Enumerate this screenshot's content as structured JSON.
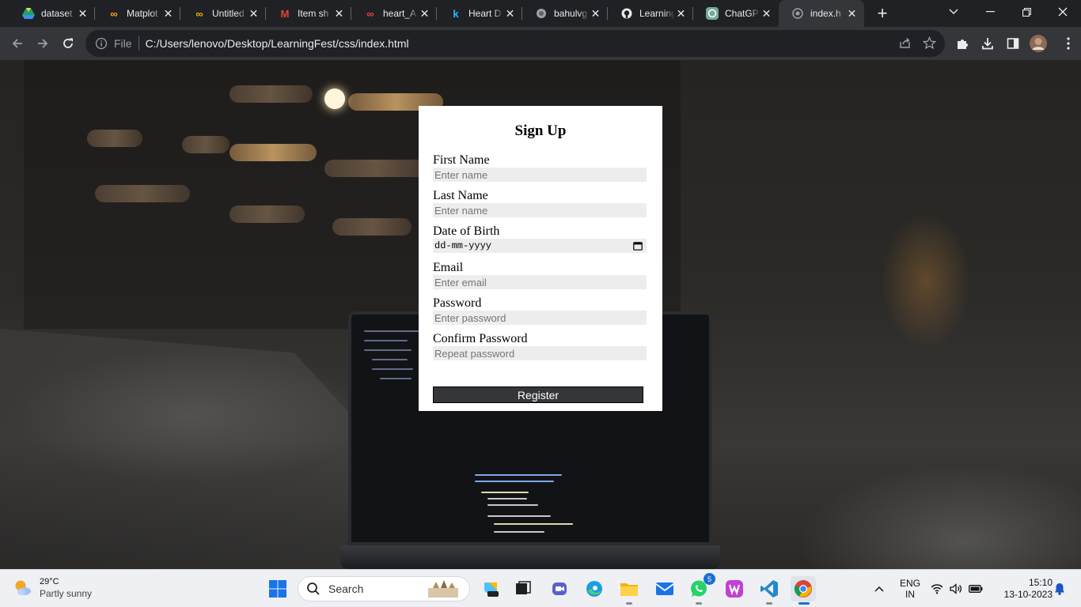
{
  "browser": {
    "tabs": [
      {
        "title": "dataset",
        "icon": "google-drive-icon"
      },
      {
        "title": "Matplot",
        "icon": "colab-icon"
      },
      {
        "title": "Untitled",
        "icon": "colab-icon"
      },
      {
        "title": "Item sh",
        "icon": "gmail-icon"
      },
      {
        "title": "heart_A",
        "icon": "colab-red-icon"
      },
      {
        "title": "Heart D",
        "icon": "kaggle-icon"
      },
      {
        "title": "bahulvg",
        "icon": "globe-icon"
      },
      {
        "title": "Learning",
        "icon": "github-icon"
      },
      {
        "title": "ChatGP",
        "icon": "chatgpt-icon"
      },
      {
        "title": "index.h",
        "icon": "globe-icon",
        "active": true
      }
    ],
    "address": {
      "scheme_label": "File",
      "url": "C:/Users/lenovo/Desktop/LearningFest/css/index.html"
    }
  },
  "signup": {
    "title": "Sign Up",
    "fields": [
      {
        "label": "First Name",
        "placeholder": "Enter name",
        "type": "text"
      },
      {
        "label": "Last Name",
        "placeholder": "Enter name",
        "type": "text"
      },
      {
        "label": "Date of Birth",
        "placeholder": "dd-mm-yyyy",
        "type": "date"
      },
      {
        "label": "Email",
        "placeholder": "Enter email",
        "type": "email"
      },
      {
        "label": "Password",
        "placeholder": "Enter password",
        "type": "password"
      },
      {
        "label": "Confirm Password",
        "placeholder": "Repeat password",
        "type": "password"
      }
    ],
    "submit_label": "Register"
  },
  "taskbar": {
    "weather": {
      "temp": "29°C",
      "condition": "Partly sunny"
    },
    "search_label": "Search",
    "whatsapp_badge": "5",
    "tray": {
      "lang_line1": "ENG",
      "lang_line2": "IN",
      "time": "15:10",
      "date": "13-10-2023"
    }
  },
  "colors": {
    "tab_strip": "#202124",
    "toolbar": "#35363a",
    "form_bg": "#ffffff",
    "input_bg": "#ededed",
    "register_bg": "#35363a",
    "taskbar": "#eef0f4"
  }
}
